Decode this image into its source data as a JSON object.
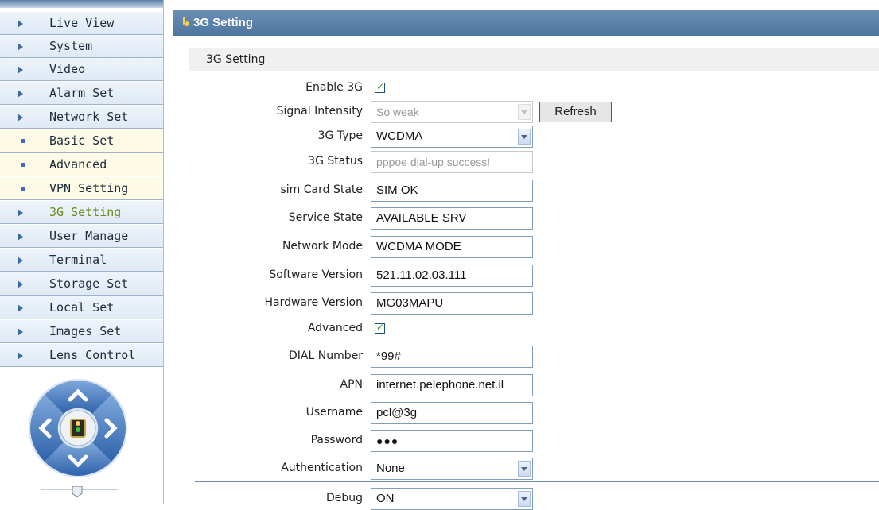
{
  "sidebar": {
    "items": [
      {
        "label": "Live View",
        "type": "main"
      },
      {
        "label": "System",
        "type": "main"
      },
      {
        "label": "Video",
        "type": "main"
      },
      {
        "label": "Alarm Set",
        "type": "main"
      },
      {
        "label": "Network Set",
        "type": "main"
      },
      {
        "label": "Basic Set",
        "type": "sub"
      },
      {
        "label": "Advanced",
        "type": "sub"
      },
      {
        "label": "VPN Setting",
        "type": "sub"
      },
      {
        "label": "3G Setting",
        "type": "main",
        "active": true
      },
      {
        "label": "User Manage",
        "type": "main"
      },
      {
        "label": "Terminal",
        "type": "main"
      },
      {
        "label": "Storage Set",
        "type": "main"
      },
      {
        "label": "Local Set",
        "type": "main"
      },
      {
        "label": "Images Set",
        "type": "main"
      },
      {
        "label": "Lens Control",
        "type": "main"
      }
    ]
  },
  "header": {
    "title": "3G Setting"
  },
  "section": {
    "title": "3G Setting"
  },
  "form": {
    "enable_3g": {
      "label": "Enable 3G",
      "checked": true
    },
    "signal_intensity": {
      "label": "Signal Intensity",
      "value": "So weak"
    },
    "refresh_label": "Refresh",
    "type_3g": {
      "label": "3G Type",
      "value": "WCDMA"
    },
    "status_3g": {
      "label": "3G Status",
      "value": "pppoe dial-up success!"
    },
    "sim_card_state": {
      "label": "sim Card State",
      "value": "SIM OK"
    },
    "service_state": {
      "label": "Service State",
      "value": "AVAILABLE SRV"
    },
    "network_mode": {
      "label": "Network Mode",
      "value": "WCDMA MODE"
    },
    "software_version": {
      "label": "Software Version",
      "value": "521.11.02.03.111"
    },
    "hardware_version": {
      "label": "Hardware Version",
      "value": "MG03MAPU"
    },
    "advanced": {
      "label": "Advanced",
      "checked": true
    },
    "dial_number": {
      "label": "DIAL Number",
      "value": "*99#"
    },
    "apn": {
      "label": "APN",
      "value": "internet.pelephone.net.il"
    },
    "username": {
      "label": "Username",
      "value": "pcl@3g"
    },
    "password": {
      "label": "Password",
      "value": "●●●"
    },
    "authentication": {
      "label": "Authentication",
      "value": "None"
    },
    "debug": {
      "label": "Debug",
      "value": "ON"
    }
  },
  "colors": {
    "accent": "#4e759f",
    "active_nav": "#6a8b17",
    "sub_nav_bg": "#fdfbe6"
  },
  "icons": {
    "ptz": [
      "up-arrow-icon",
      "down-arrow-icon",
      "left-arrow-icon",
      "right-arrow-icon",
      "traffic-light-icon"
    ]
  }
}
